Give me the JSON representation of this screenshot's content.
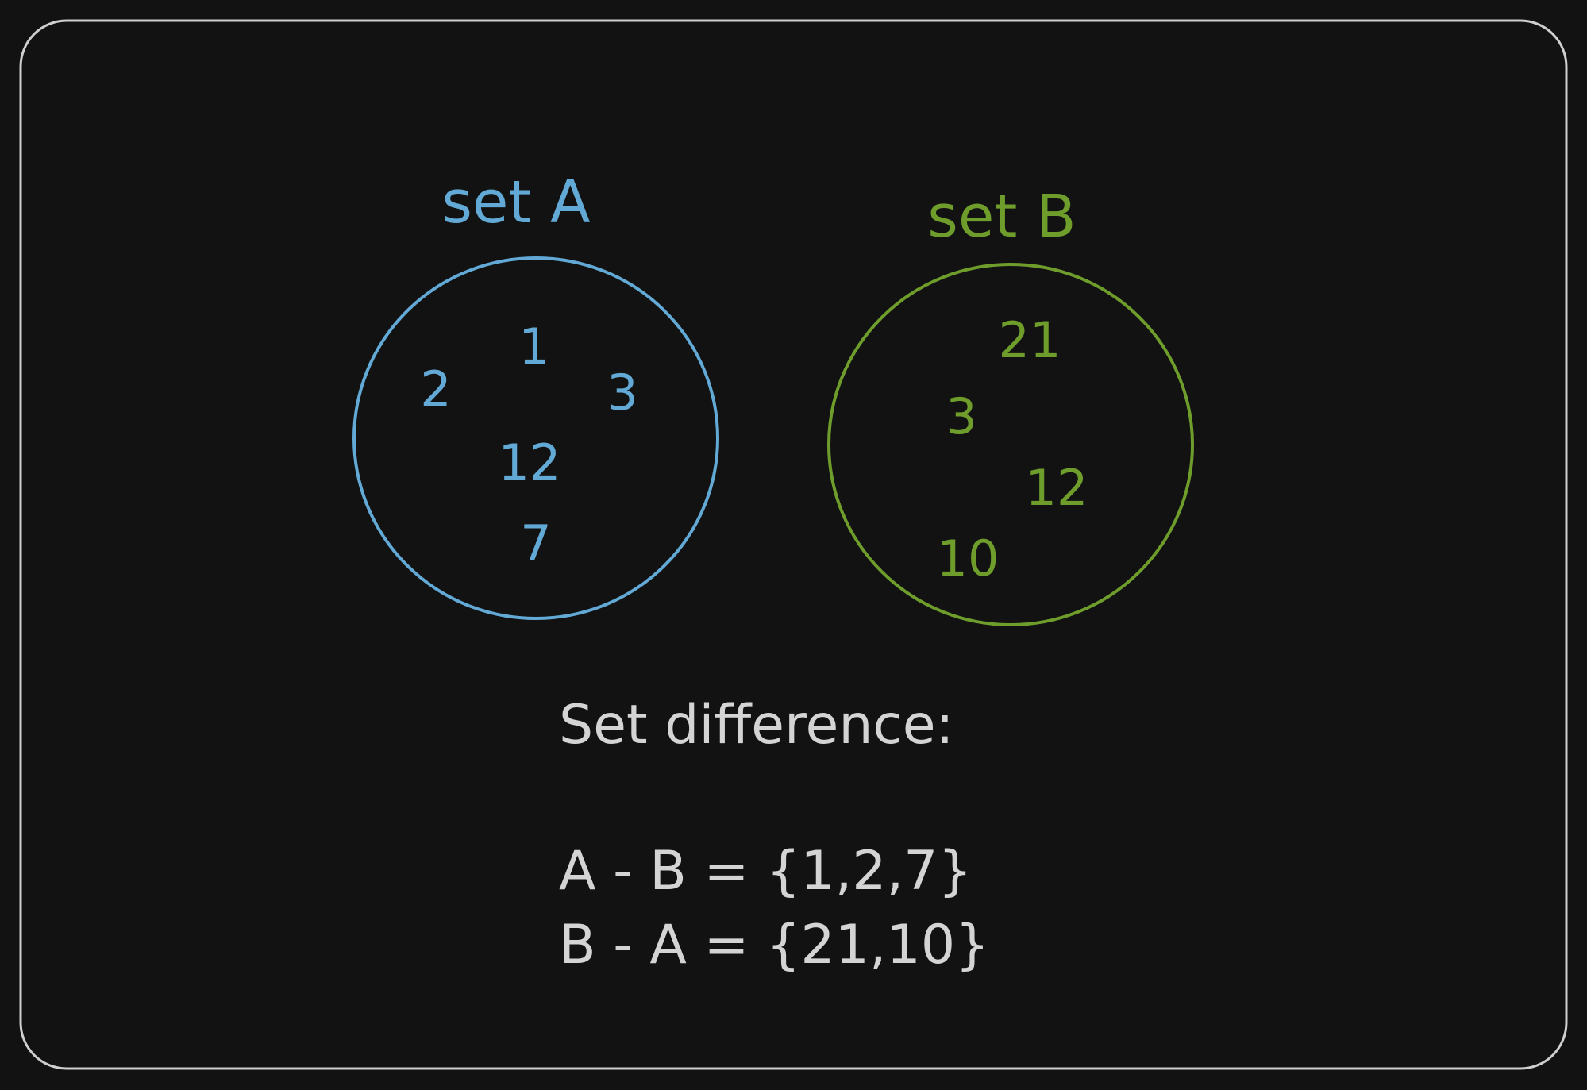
{
  "colors": {
    "background": "#121212",
    "frame": "#cfcfcf",
    "set_a": "#62a9d6",
    "set_b": "#6e9d2c",
    "text": "#d4d4d4"
  },
  "set_a": {
    "title": "set A",
    "elements": [
      "1",
      "2",
      "3",
      "12",
      "7"
    ]
  },
  "set_b": {
    "title": "set B",
    "elements": [
      "21",
      "3",
      "12",
      "10"
    ]
  },
  "difference": {
    "heading": "Set difference:",
    "a_minus_b": "A - B = {1,2,7}",
    "b_minus_a": "B - A = {21,10}"
  }
}
